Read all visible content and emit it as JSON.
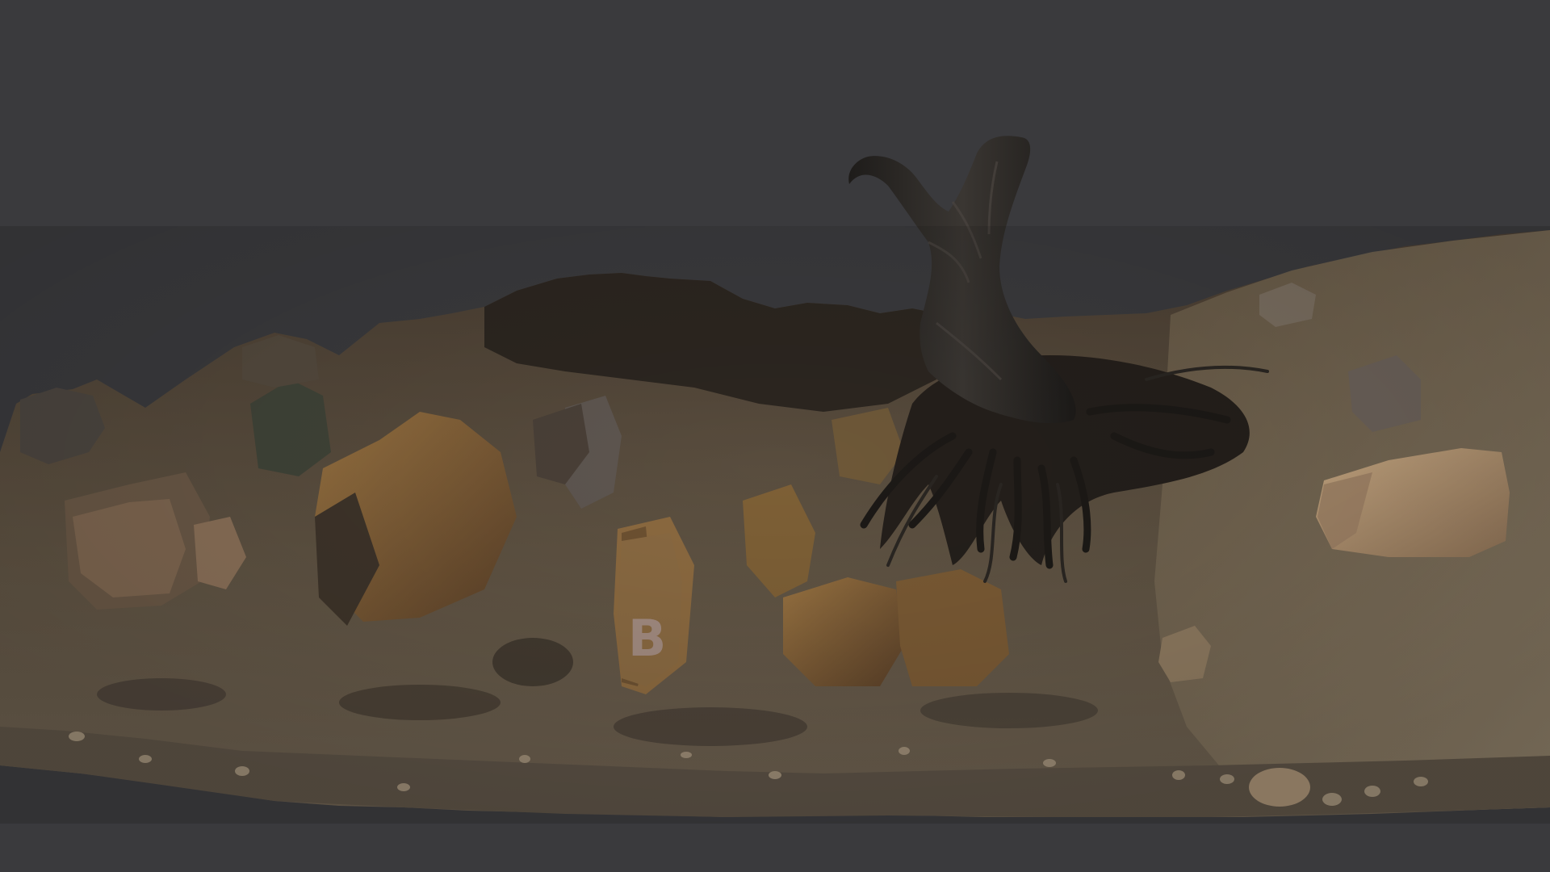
{
  "scene": {
    "background_color": "#3a3a3d",
    "subject": "photogrammetry-rock-outcrop",
    "painted_mark": "B",
    "colors": {
      "rock_dark": "#2a2520",
      "rock_mid": "#5a4a38",
      "rock_ochre": "#8a6838",
      "rock_light": "#b09070",
      "soil": "#6e6250",
      "gravel": "#4e463c",
      "stump_bark": "#2c2a28",
      "root": "#23201d"
    }
  }
}
